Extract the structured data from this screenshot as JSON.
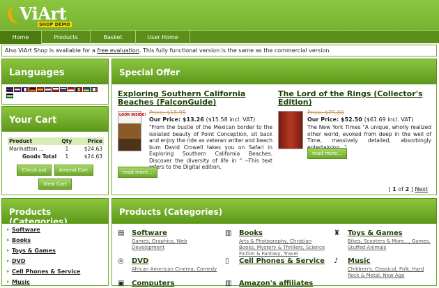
{
  "logo": {
    "name": "ViArt",
    "sub": "SHOP DEMO"
  },
  "menu": {
    "items": [
      "Home",
      "Products",
      "Basket",
      "User Home"
    ]
  },
  "info": {
    "prefix": "Also ViArt Shop is available for a ",
    "link": "free evaluation",
    "suffix": ". This fully functional version is the same as the commercial version."
  },
  "languages": {
    "title": "Languages"
  },
  "cart": {
    "title": "Your Cart",
    "headers": [
      "Product",
      "Qty",
      "Price"
    ],
    "rows": [
      {
        "product": "Manhattan ...",
        "qty": "1",
        "price": "$24.63"
      }
    ],
    "total_label": "Goods Total",
    "total_qty": "1",
    "total_price": "$24.63",
    "buttons": [
      "Check out",
      "Amend Cart",
      "View Cart"
    ]
  },
  "left_categories": {
    "title": "Products (Categories)",
    "items": [
      "Software",
      "Books",
      "Toys & Games",
      "DVD",
      "Cell Phones & Service",
      "Music"
    ]
  },
  "special_offer": {
    "title": "Special Offer",
    "products": [
      {
        "title": "Exploring Southern California Beaches (FalconGuide)",
        "old_price": "Price: $18.95",
        "our_price": "Our Price: $13.26",
        "incl": "($15.58 incl. VAT)",
        "desc": "\"From the bustle of the Mexican border to the isolated beauty of Point Conception, sit back and enjoy the ride as veteran writer and beach bum David Crowell takes you on Safari in Exploring Southern California Beaches. Discover the diversity of life in \" --This text refers to the Digital edition.",
        "read_more": "read more...",
        "cover_text": "LOOK INSIDE!"
      },
      {
        "title": "The Lord of the Rings (Collector's Edition)",
        "old_price": "Price: $75.00",
        "our_price": "Our Price: $52.50",
        "incl": "($61.69 incl. VAT)",
        "desc": "The New York Times \"A unique, wholly realized other world, evoked from deep in the well of Time, massively detailed, absorbingly entertaining...\"",
        "read_more": "read more..."
      }
    ],
    "pager": {
      "open": "[",
      "current": "1",
      "of": "of",
      "total": "2",
      "close": "]",
      "next": "Next"
    }
  },
  "categories_block": {
    "title": "Products (Categories)",
    "cells": [
      {
        "title": "Software",
        "subs": "Games, Graphics, Web Development",
        "icon": "software-icon",
        "glyph": "▤"
      },
      {
        "title": "Books",
        "subs": "Arts & Photography, Christian Books, Mystery & Thrillers, Science Fiction & Fantasy, Travel",
        "icon": "books-icon",
        "glyph": "▥"
      },
      {
        "title": "Toys & Games",
        "subs": "Bikes, Scooters & More..., Games, Stuffed Animals",
        "icon": "toys-icon",
        "glyph": "♜"
      },
      {
        "title": "DVD",
        "subs": "African American Cinema, Comedy",
        "icon": "dvd-icon",
        "glyph": "◎"
      },
      {
        "title": "Cell Phones & Service",
        "subs": "",
        "icon": "phone-icon",
        "glyph": "▯"
      },
      {
        "title": "Music",
        "subs": "Children's, Classical, Folk, Hard Rock & Metal, New Age",
        "icon": "music-icon",
        "glyph": "♪"
      },
      {
        "title": "Computers",
        "subs": "",
        "icon": "computer-icon",
        "glyph": "▣"
      },
      {
        "title": "Amazon's affiliates",
        "subs": "",
        "icon": "amazon-icon",
        "glyph": "▥"
      }
    ]
  },
  "colors": {
    "brand_green": "#6ea92a",
    "dark_green": "#5b8e1b",
    "logo_orange": "#f6a800"
  }
}
